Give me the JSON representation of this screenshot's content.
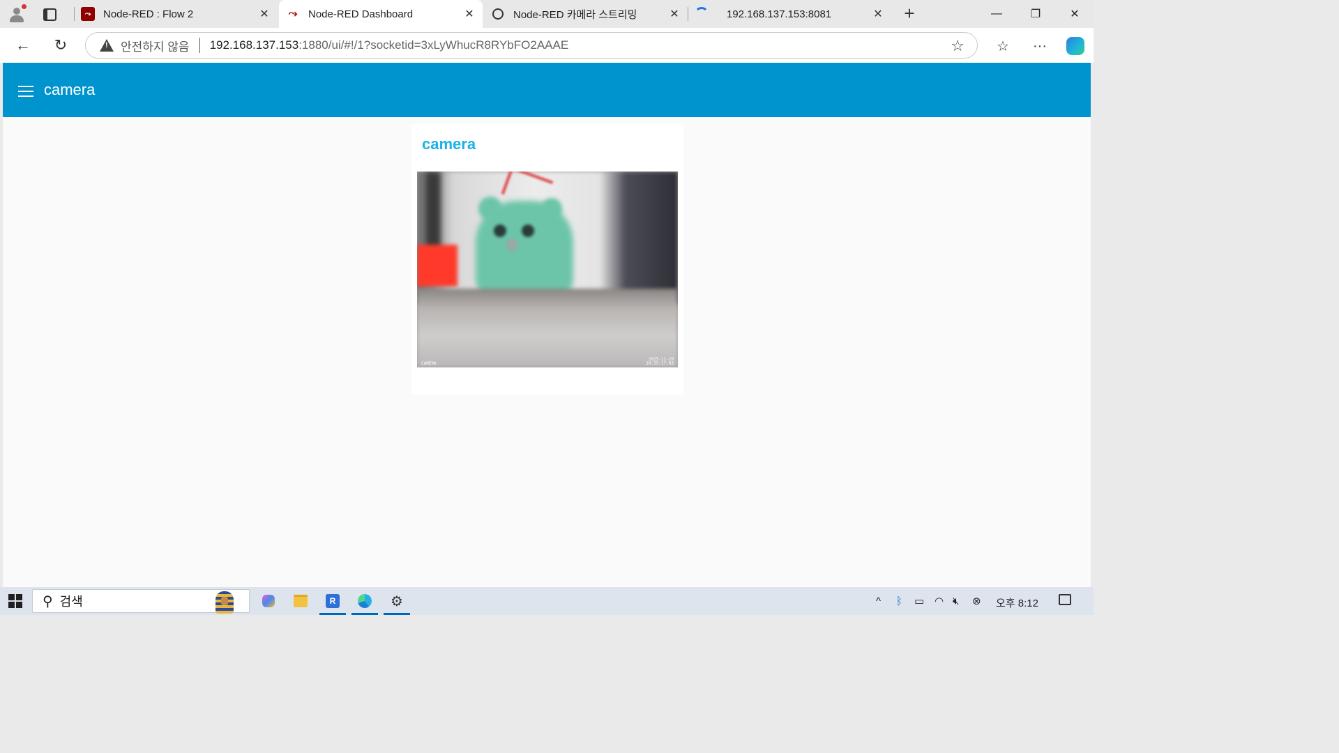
{
  "browser": {
    "tabs": [
      {
        "title": "Node-RED : Flow 2",
        "favicon": "node-red-icon",
        "active": false
      },
      {
        "title": "Node-RED Dashboard",
        "favicon": "node-red-dashboard-icon",
        "active": true
      },
      {
        "title": "Node-RED 카메라 스트리밍",
        "favicon": "openai-icon",
        "active": false
      },
      {
        "title": "192.168.137.153:8081",
        "favicon": "loading-icon",
        "active": false
      }
    ],
    "close_glyph": "✕",
    "new_tab_glyph": "+",
    "window_controls": {
      "minimize": "—",
      "restore": "❐",
      "close": "✕"
    },
    "address": {
      "security_label": "안전하지 않음",
      "host": "192.168.137.153",
      "rest": ":1880/ui/#!/1?socketid=3xLyWhucR8RYbFO2AAAE"
    },
    "nav": {
      "back": "←",
      "reload": "↻",
      "star": "☆",
      "favorites": "☆",
      "more": "···"
    }
  },
  "dashboard": {
    "header_title": "camera",
    "accent": "#0094ce",
    "card": {
      "title": "camera",
      "title_color": "#1bb2e6",
      "image_timestamp": "2025-11-20\n20:35:17:03",
      "image_watermark": "CAMERA"
    }
  },
  "taskbar": {
    "search_placeholder": "검색",
    "search_glyph": "⚲",
    "apps": [
      "copilot-icon",
      "file-explorer-icon",
      "app-icon",
      "edge-icon",
      "settings-icon"
    ],
    "app_label": "R",
    "settings_glyph": "⚙",
    "tray": {
      "chevron": "^",
      "bluetooth": "ᛒ",
      "battery": "▭",
      "wifi": "◠",
      "volume": "🔇︎",
      "status": "⊗"
    },
    "clock": "오후 8:12"
  }
}
